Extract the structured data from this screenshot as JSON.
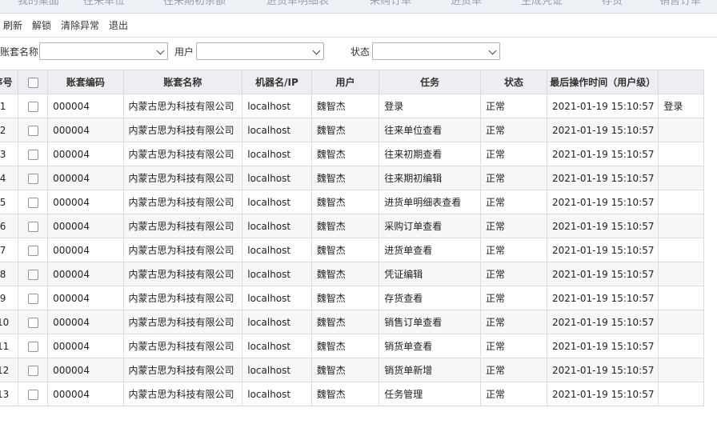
{
  "tabs": [
    "我的桌面",
    "往来单位",
    "往来期初余额",
    "进货单明细表",
    "采购订单",
    "进货单",
    "生成凭证",
    "存货",
    "销售订单"
  ],
  "toolbar": {
    "refresh": "刷新",
    "unlock": "解锁",
    "clear_exceptions": "清除异常",
    "exit": "退出"
  },
  "filters": {
    "account_set_label": "账套名称",
    "user_label": "用户",
    "status_label": "状态"
  },
  "table": {
    "headers": {
      "index": "序号",
      "code": "账套编码",
      "name": "账套名称",
      "machine": "机器名/IP",
      "user": "用户",
      "task": "任务",
      "status": "状态",
      "time": "最后操作时间（用户级）",
      "extra": ""
    },
    "rows": [
      {
        "index": "1",
        "code": "000004",
        "name": "内蒙古思为科技有限公司",
        "machine": "localhost",
        "user": "魏智杰",
        "task": "登录",
        "status": "正常",
        "time": "2021-01-19 15:10:57",
        "extra": "登录"
      },
      {
        "index": "2",
        "code": "000004",
        "name": "内蒙古思为科技有限公司",
        "machine": "localhost",
        "user": "魏智杰",
        "task": "往来单位查看",
        "status": "正常",
        "time": "2021-01-19 15:10:57",
        "extra": ""
      },
      {
        "index": "3",
        "code": "000004",
        "name": "内蒙古思为科技有限公司",
        "machine": "localhost",
        "user": "魏智杰",
        "task": "往来初期查看",
        "status": "正常",
        "time": "2021-01-19 15:10:57",
        "extra": ""
      },
      {
        "index": "4",
        "code": "000004",
        "name": "内蒙古思为科技有限公司",
        "machine": "localhost",
        "user": "魏智杰",
        "task": "往来期初编辑",
        "status": "正常",
        "time": "2021-01-19 15:10:57",
        "extra": ""
      },
      {
        "index": "5",
        "code": "000004",
        "name": "内蒙古思为科技有限公司",
        "machine": "localhost",
        "user": "魏智杰",
        "task": "进货单明细表查看",
        "status": "正常",
        "time": "2021-01-19 15:10:57",
        "extra": ""
      },
      {
        "index": "6",
        "code": "000004",
        "name": "内蒙古思为科技有限公司",
        "machine": "localhost",
        "user": "魏智杰",
        "task": "采购订单查看",
        "status": "正常",
        "time": "2021-01-19 15:10:57",
        "extra": ""
      },
      {
        "index": "7",
        "code": "000004",
        "name": "内蒙古思为科技有限公司",
        "machine": "localhost",
        "user": "魏智杰",
        "task": "进货单查看",
        "status": "正常",
        "time": "2021-01-19 15:10:57",
        "extra": ""
      },
      {
        "index": "8",
        "code": "000004",
        "name": "内蒙古思为科技有限公司",
        "machine": "localhost",
        "user": "魏智杰",
        "task": "凭证编辑",
        "status": "正常",
        "time": "2021-01-19 15:10:57",
        "extra": ""
      },
      {
        "index": "9",
        "code": "000004",
        "name": "内蒙古思为科技有限公司",
        "machine": "localhost",
        "user": "魏智杰",
        "task": "存货查看",
        "status": "正常",
        "time": "2021-01-19 15:10:57",
        "extra": ""
      },
      {
        "index": "10",
        "code": "000004",
        "name": "内蒙古思为科技有限公司",
        "machine": "localhost",
        "user": "魏智杰",
        "task": "销售订单查看",
        "status": "正常",
        "time": "2021-01-19 15:10:57",
        "extra": ""
      },
      {
        "index": "11",
        "code": "000004",
        "name": "内蒙古思为科技有限公司",
        "machine": "localhost",
        "user": "魏智杰",
        "task": "销货单查看",
        "status": "正常",
        "time": "2021-01-19 15:10:57",
        "extra": ""
      },
      {
        "index": "12",
        "code": "000004",
        "name": "内蒙古思为科技有限公司",
        "machine": "localhost",
        "user": "魏智杰",
        "task": "销货单新增",
        "status": "正常",
        "time": "2021-01-19 15:10:57",
        "extra": ""
      },
      {
        "index": "13",
        "code": "000004",
        "name": "内蒙古思为科技有限公司",
        "machine": "localhost",
        "user": "魏智杰",
        "task": "任务管理",
        "status": "正常",
        "time": "2021-01-19 15:10:57",
        "extra": ""
      }
    ]
  }
}
